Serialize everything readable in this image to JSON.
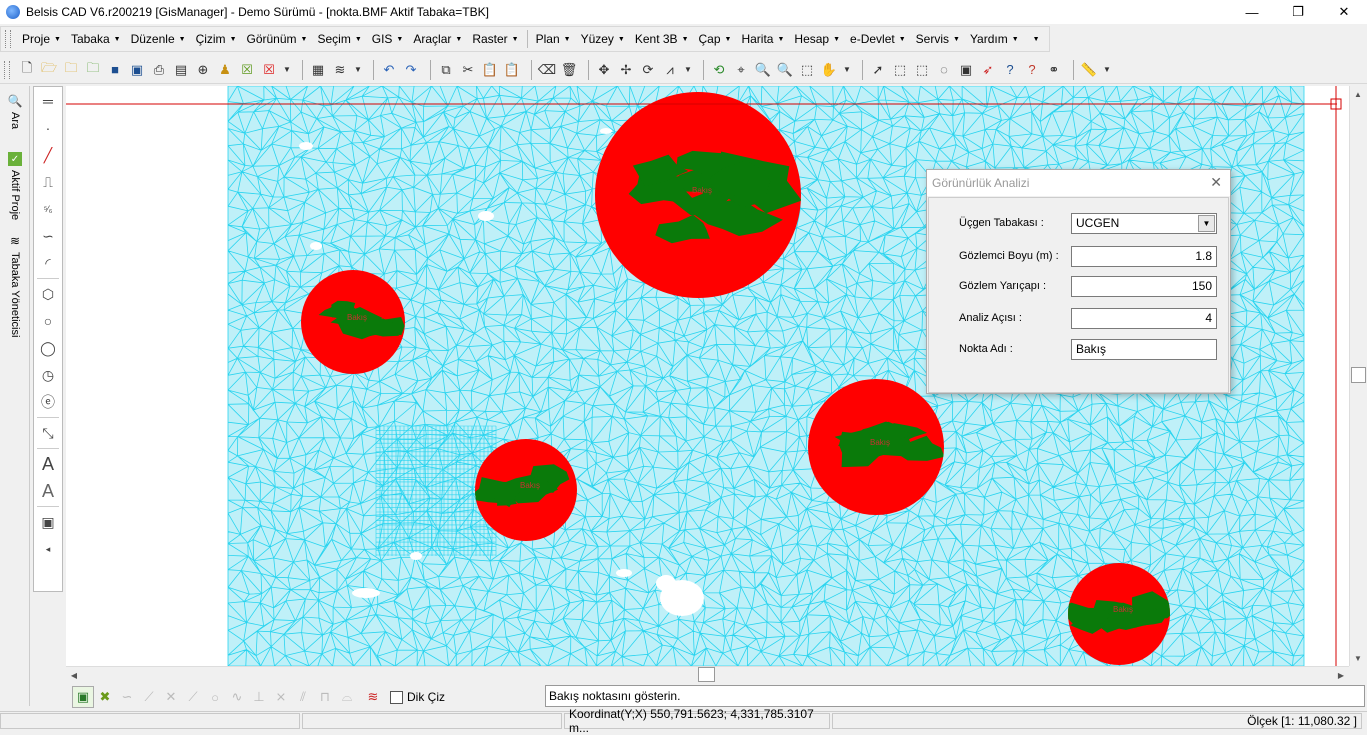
{
  "window": {
    "title": "Belsis CAD V6.r200219 [GisManager] - Demo Sürümü - [nokta.BMF  Aktif Tabaka=TBK]",
    "minimize": "—",
    "maximize": "❐",
    "close": "✕"
  },
  "menu": {
    "items": [
      "Proje",
      "Tabaka",
      "Düzenle",
      "Çizim",
      "Görünüm",
      "Seçim",
      "GIS",
      "Araçlar",
      "Raster",
      "Plan",
      "Yüzey",
      "Kent 3B",
      "Çap",
      "Harita",
      "Hesap",
      "e-Devlet",
      "Servis",
      "Yardım"
    ]
  },
  "side_tabs": {
    "search": "Ara",
    "active_project": "Aktif Proje",
    "layer_manager": "Tabaka Yöneticisi"
  },
  "dialog": {
    "title": "Görünürlük Analizi",
    "fields": {
      "layer_label": "Üçgen Tabakası :",
      "layer_value": "UCGEN",
      "observer_height_label": "Gözlemci Boyu (m) :",
      "observer_height_value": "1.8",
      "radius_label": "Gözlem Yarıçapı :",
      "radius_value": "150",
      "angle_label": "Analiz Açısı :",
      "angle_value": "4",
      "point_name_label": "Nokta Adı :",
      "point_name_value": "Bakış"
    }
  },
  "map": {
    "mesh_color": "#2ad4ef",
    "visible_color": "#ff0000",
    "hidden_color": "#0a7a0a",
    "point_label": "Bakış",
    "point_count": 5
  },
  "bottom": {
    "ortho_label": "Dik Çiz",
    "command_prompt": "Bakış noktasını gösterin."
  },
  "status": {
    "coordinate": "Koordinat(Y;X)  550,791.5623; 4,331,785.3107 m...",
    "scale": "Ölçek [1: 11,080.32 ]"
  }
}
